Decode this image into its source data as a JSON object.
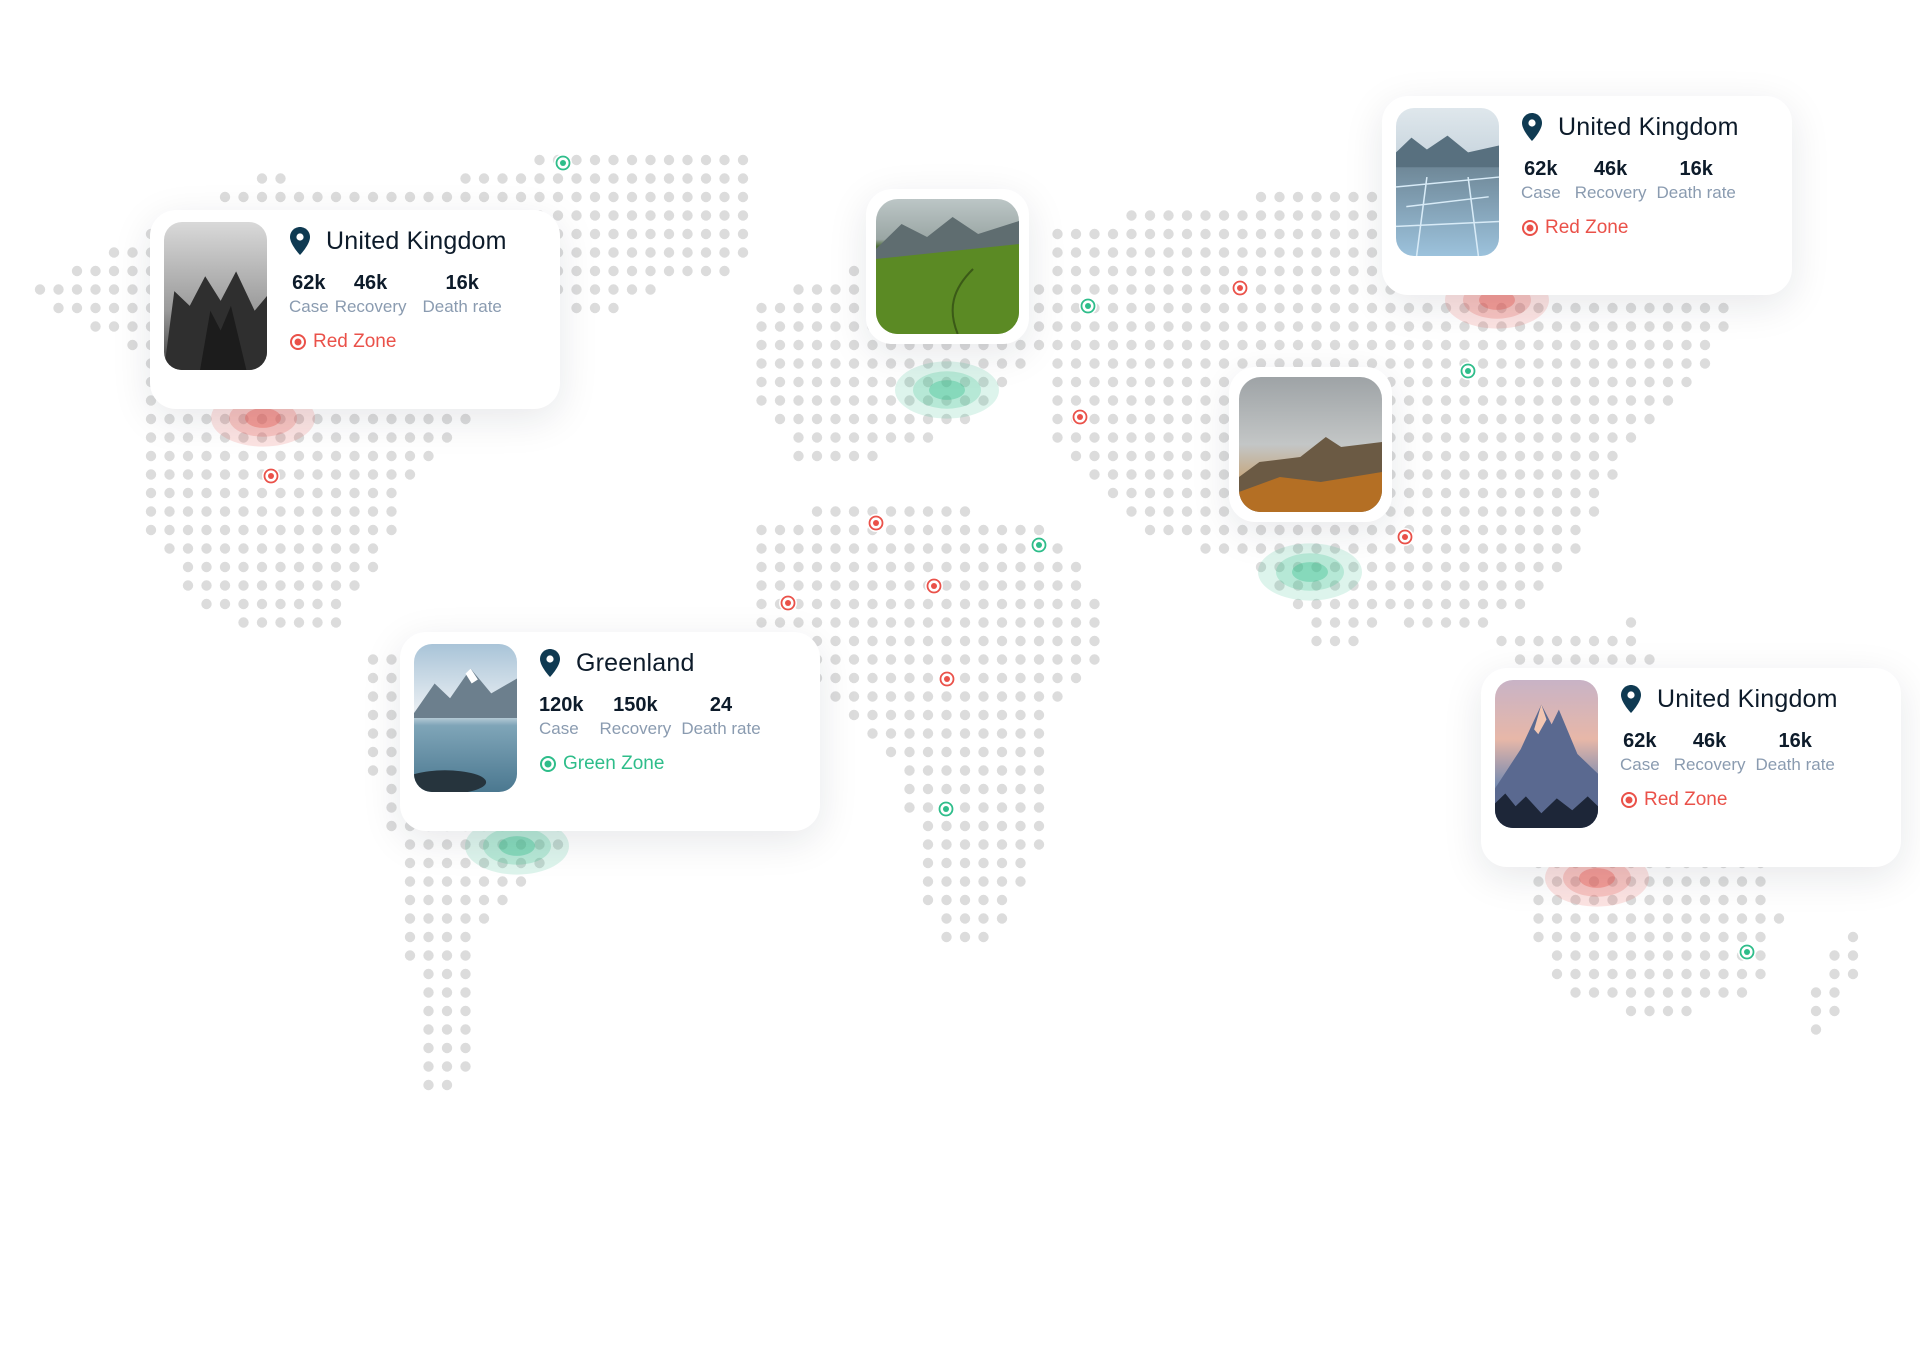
{
  "colors": {
    "dot": "#dcdcdc",
    "red": "#ea5149",
    "green": "#2ebd8a",
    "pin": "#0f3a52",
    "label": "#8a9bb0"
  },
  "markers": [
    {
      "zone": "green"
    },
    {
      "zone": "red"
    },
    {
      "zone": "green"
    },
    {
      "zone": "red"
    },
    {
      "zone": "red"
    },
    {
      "zone": "green"
    },
    {
      "zone": "red"
    },
    {
      "zone": "red"
    },
    {
      "zone": "red"
    },
    {
      "zone": "red"
    },
    {
      "zone": "green"
    },
    {
      "zone": "red"
    },
    {
      "zone": "green"
    },
    {
      "zone": "green"
    },
    {
      "zone": "green"
    }
  ],
  "cards": [
    {
      "title": "United Kingdom",
      "stats": [
        {
          "value": "62k",
          "label": "Case"
        },
        {
          "value": "46k",
          "label": "Recovery"
        },
        {
          "value": "16k",
          "label": "Death rate"
        }
      ],
      "zone": "Red Zone",
      "zone_type": "red",
      "image_icon": "mountain-fog-photo"
    },
    {
      "title": "Greenland",
      "stats": [
        {
          "value": "120k",
          "label": "Case"
        },
        {
          "value": "150k",
          "label": "Recovery"
        },
        {
          "value": "24",
          "label": "Death rate"
        }
      ],
      "zone": "Green Zone",
      "zone_type": "green",
      "image_icon": "glacier-lake-photo"
    },
    {
      "title": "United Kingdom",
      "stats": [
        {
          "value": "62k",
          "label": "Case"
        },
        {
          "value": "46k",
          "label": "Recovery"
        },
        {
          "value": "16k",
          "label": "Death rate"
        }
      ],
      "zone": "Red Zone",
      "zone_type": "red",
      "image_icon": "ice-field-photo"
    },
    {
      "title": "United Kingdom",
      "stats": [
        {
          "value": "62k",
          "label": "Case"
        },
        {
          "value": "46k",
          "label": "Recovery"
        },
        {
          "value": "16k",
          "label": "Death rate"
        }
      ],
      "zone": "Red Zone",
      "zone_type": "red",
      "image_icon": "alpine-peak-photo"
    }
  ],
  "photo_cards": [
    {
      "image_icon": "green-valley-photo",
      "zone_type": "green"
    },
    {
      "image_icon": "canyon-cliff-photo",
      "zone_type": "green"
    }
  ]
}
